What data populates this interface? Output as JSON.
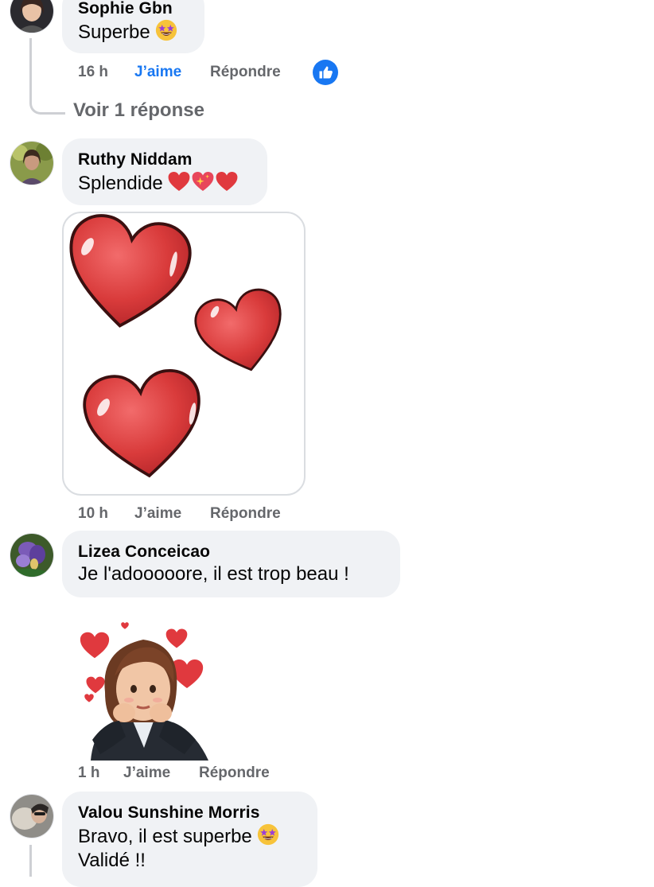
{
  "comments": [
    {
      "author": "Sophie Gbn",
      "text": "Superbe",
      "emoji": "star-struck-emoji",
      "time": "16 h",
      "like_label": "J’aime",
      "reply_label": "Répondre",
      "liked": true,
      "reaction": "like-reaction-icon",
      "view_replies": "Voir 1 réponse"
    },
    {
      "author": "Ruthy Niddam",
      "text": "Splendide",
      "emojis": [
        "red-heart-emoji",
        "sparkling-heart-emoji",
        "red-heart-emoji"
      ],
      "attachment": "three-red-hearts-sticker",
      "time": "10 h",
      "like_label": "J’aime",
      "reply_label": "Répondre"
    },
    {
      "author": "Lizea Conceicao",
      "text": "Je l'adooooore, il est trop beau !",
      "attachment": "avatar-with-hearts-sticker",
      "time": "1 h",
      "like_label": "J’aime",
      "reply_label": "Répondre"
    },
    {
      "author": "Valou Sunshine Morris",
      "text_line1": "Bravo, il est superbe",
      "emoji": "star-struck-emoji",
      "text_line2": "Validé !!"
    }
  ],
  "colors": {
    "bubble": "#f0f2f5",
    "secondary_text": "#65676b",
    "accent": "#1877f2",
    "heart": "#e0393e"
  }
}
